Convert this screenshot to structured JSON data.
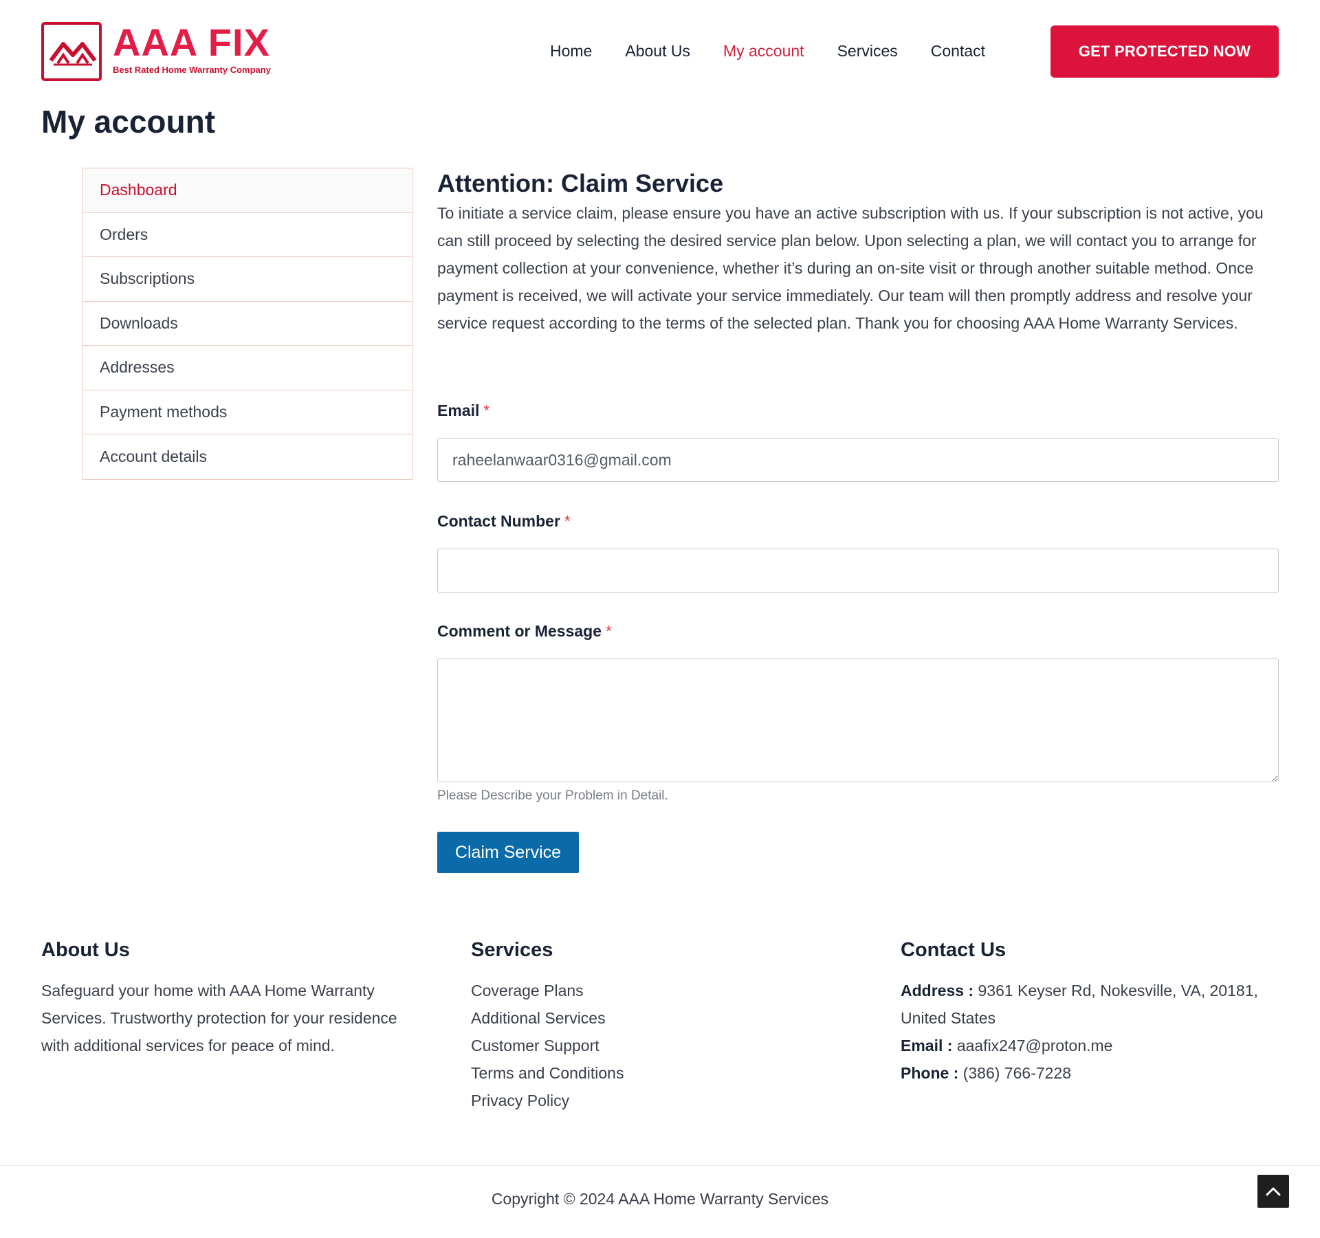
{
  "brand": {
    "name": "AAA FIX",
    "tagline": "Best Rated Home Warranty Company",
    "color": "#e11d48"
  },
  "nav": {
    "items": [
      {
        "label": "Home"
      },
      {
        "label": "About Us"
      },
      {
        "label": "My account",
        "active": true
      },
      {
        "label": "Services"
      },
      {
        "label": "Contact"
      }
    ],
    "cta_label": "GET PROTECTED NOW"
  },
  "page": {
    "title": "My account"
  },
  "sidebar": {
    "items": [
      {
        "label": "Dashboard",
        "active": true
      },
      {
        "label": "Orders"
      },
      {
        "label": "Subscriptions"
      },
      {
        "label": "Downloads"
      },
      {
        "label": "Addresses"
      },
      {
        "label": "Payment methods"
      },
      {
        "label": "Account details"
      }
    ]
  },
  "claim": {
    "title": "Attention: Claim Service",
    "body": "To initiate a service claim, please ensure you have an active subscription with us. If your subscription is not active, you can still proceed by selecting the desired service plan below. Upon selecting a plan, we will contact you to arrange for payment collection at your convenience, whether it’s during an on-site visit or through another suitable method. Once payment is received, we will activate your service immediately. Our team will then promptly address and resolve your service request according to the terms of the selected plan. Thank you for choosing AAA Home Warranty Services.",
    "form": {
      "required_mark": "*",
      "email_label": "Email",
      "email_value": "raheelanwaar0316@gmail.com",
      "contact_label": "Contact Number",
      "contact_value": "",
      "message_label": "Comment or Message",
      "message_value": "",
      "message_helper": "Please Describe your Problem in Detail.",
      "submit_label": "Claim Service"
    }
  },
  "footer": {
    "about": {
      "heading": "About Us",
      "text": "Safeguard your home with AAA Home Warranty Services. Trustworthy protection for your residence with additional services for peace of mind."
    },
    "services": {
      "heading": "Services",
      "links": [
        "Coverage Plans",
        "Additional Services",
        "Customer Support",
        "Terms and Conditions",
        "Privacy Policy"
      ]
    },
    "contact": {
      "heading": "Contact Us",
      "address_label": "Address :",
      "address_value": "9361 Keyser Rd, Nokesville, VA, 20181, United States",
      "email_label": "Email :",
      "email_value": "aaafix247@proton.me",
      "phone_label": "Phone :",
      "phone_value": "(386) 766-7228"
    },
    "copyright": "Copyright © 2024 AAA Home Warranty Services"
  },
  "icons": {
    "logo": "house-roof-icon",
    "scroll_top": "chevron-up-icon"
  }
}
